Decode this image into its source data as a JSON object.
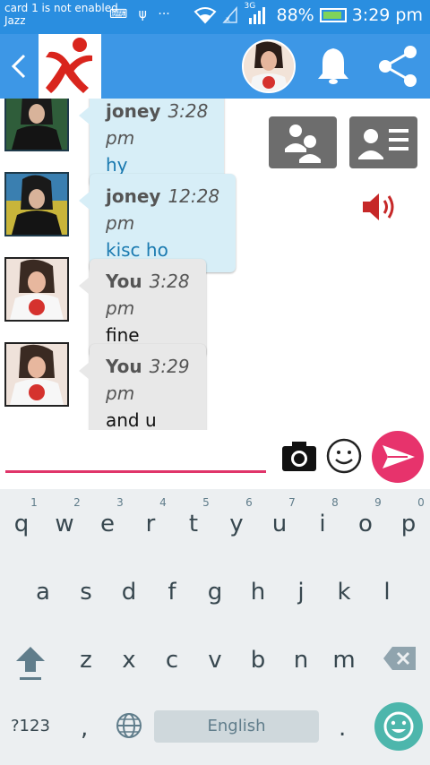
{
  "status_bar": {
    "sim_line1": "card 1 is not enabled",
    "sim_line2": "Jazz",
    "network_label": "3G",
    "battery": "88%",
    "time": "3:29 pm"
  },
  "messages": [
    {
      "sender": "joney",
      "time": "3:28 pm",
      "text": "hy"
    },
    {
      "sender": "joney",
      "time": "12:28 pm",
      "text": "kisc ho"
    },
    {
      "sender": "You",
      "time": "3:28 pm",
      "text": "fine"
    },
    {
      "sender": "You",
      "time": "3:29 pm",
      "text": "and u"
    }
  ],
  "keyboard": {
    "row1": [
      "q",
      "w",
      "e",
      "r",
      "t",
      "y",
      "u",
      "i",
      "o",
      "p"
    ],
    "row1_hints": [
      "1",
      "2",
      "3",
      "4",
      "5",
      "6",
      "7",
      "8",
      "9",
      "0"
    ],
    "row2": [
      "a",
      "s",
      "d",
      "f",
      "g",
      "h",
      "j",
      "k",
      "l"
    ],
    "row3": [
      "z",
      "x",
      "c",
      "v",
      "b",
      "n",
      "m"
    ],
    "symbols_key": "?123",
    "comma": ",",
    "period": ".",
    "space_label": "English"
  },
  "colors": {
    "status_bar": "#2a8ee0",
    "app_bar": "#3d97e6",
    "accent_pink": "#e7336c",
    "bubble_them": "#d7eef7",
    "bubble_me": "#e8e8e8"
  }
}
